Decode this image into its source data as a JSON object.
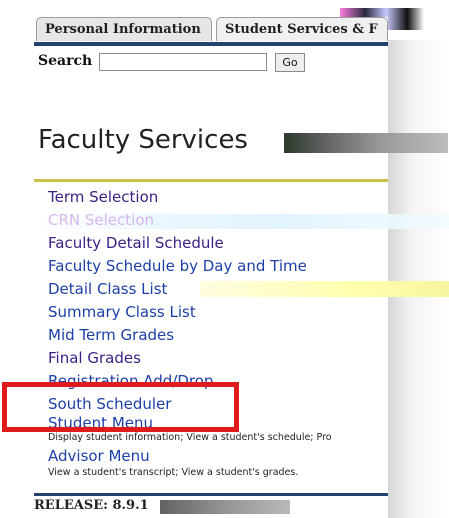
{
  "tabs": [
    {
      "label": "Personal Information"
    },
    {
      "label": "Student Services & F"
    }
  ],
  "search": {
    "label": "Search",
    "value": "",
    "placeholder": "",
    "go_label": "Go"
  },
  "page": {
    "title": "Faculty Services"
  },
  "menu": {
    "items": [
      {
        "label": "Term Selection"
      },
      {
        "label": "CRN Selection"
      },
      {
        "label": "Faculty Detail Schedule"
      },
      {
        "label": "Faculty Schedule by Day and Time"
      },
      {
        "label": "Detail Class List"
      },
      {
        "label": "Summary Class List"
      },
      {
        "label": "Mid Term Grades"
      },
      {
        "label": "Final Grades"
      },
      {
        "label": "Registration Add/Drop"
      },
      {
        "label": "South Scheduler"
      },
      {
        "label": "Student Menu"
      }
    ],
    "student_menu_desc": "Display student information; View a student's schedule; Pro",
    "advisor_menu_label": "Advisor Menu",
    "advisor_menu_desc": "View a student's transcript; View a student's grades."
  },
  "footer": {
    "release": "RELEASE: 8.9.1"
  },
  "colors": {
    "tab_underline": "#23436e",
    "gold_rule": "#c8c04a",
    "link": "#3b1f86",
    "link_blue": "#1c3fa8",
    "highlight_box": "#e01b1b"
  }
}
